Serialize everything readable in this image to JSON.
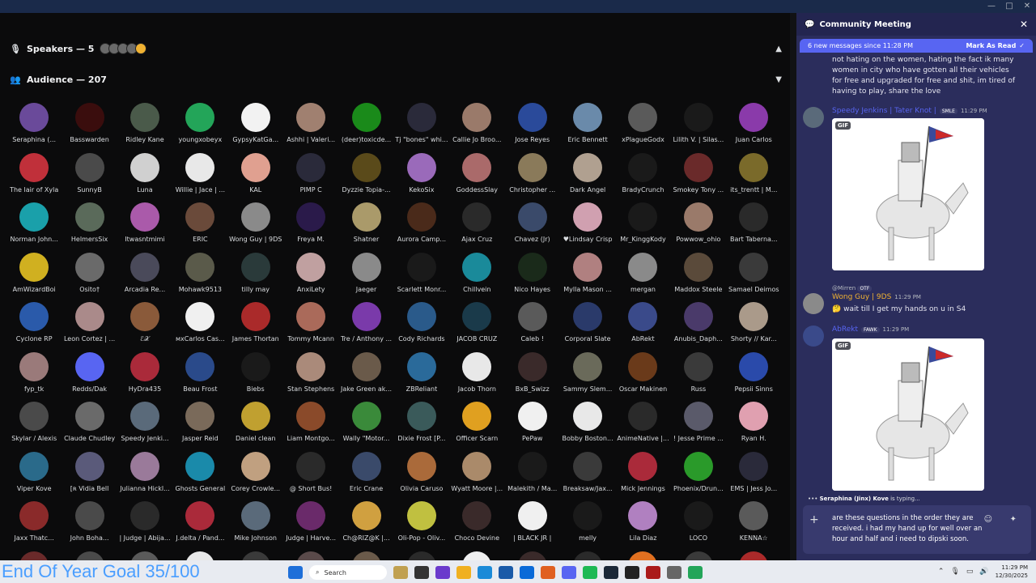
{
  "window": {
    "controls": [
      "—",
      "□",
      "✕"
    ]
  },
  "stage": {
    "speakers": {
      "label": "Speakers — 5"
    },
    "audience": {
      "label": "Audience — 207"
    },
    "members": [
      {
        "name": "Seraphina (...",
        "c": "#6a4a9a"
      },
      {
        "name": "Basswarden",
        "c": "#3a0d0d"
      },
      {
        "name": "Ridley Kane",
        "c": "#4a5a4a"
      },
      {
        "name": "youngxobeyx",
        "c": "#23a559"
      },
      {
        "name": "GypsyKatGa...",
        "c": "#f2f2f2"
      },
      {
        "name": "Ashhi | Valeri...",
        "c": "#a08070"
      },
      {
        "name": "(deer)toxicde...",
        "c": "#1a8a1a"
      },
      {
        "name": "Tj \"bones\" whi...",
        "c": "#2a2a3a"
      },
      {
        "name": "Callie Jo Broo...",
        "c": "#9a7a6a"
      },
      {
        "name": "Jose Reyes",
        "c": "#2a4a9a"
      },
      {
        "name": "Eric Bennett",
        "c": "#6a8aaa"
      },
      {
        "name": "xPlagueGodx",
        "c": "#5a5a5a"
      },
      {
        "name": "Lilith V. | Silas...",
        "c": "#1a1a1a"
      },
      {
        "name": "Juan Carlos",
        "c": "#8a3aaa"
      },
      {
        "name": "The lair of Xyla",
        "c": "#c0303a"
      },
      {
        "name": "SunnyB",
        "c": "#4a4a4a"
      },
      {
        "name": "Luna",
        "c": "#d0d0d0"
      },
      {
        "name": "Willie | Jace | ...",
        "c": "#e8e8e8"
      },
      {
        "name": "KAL",
        "c": "#e0a090"
      },
      {
        "name": "PIMP C",
        "c": "#2a2a3a"
      },
      {
        "name": "Dyzzie Topia-...",
        "c": "#5a4a1a"
      },
      {
        "name": "KekoSix",
        "c": "#9a6aba"
      },
      {
        "name": "GoddessSlay",
        "c": "#aa6a6a"
      },
      {
        "name": "Christopher ...",
        "c": "#8a7a5a"
      },
      {
        "name": "Dark Angel",
        "c": "#b0a090"
      },
      {
        "name": "BradyCrunch",
        "c": "#1a1a1a"
      },
      {
        "name": "Smokey Tony ...",
        "c": "#6a2a2a"
      },
      {
        "name": "its_trentt | M...",
        "c": "#7a6a2a"
      },
      {
        "name": "Norman John...",
        "c": "#1aa0aa"
      },
      {
        "name": "HelmersSix",
        "c": "#5a6a5a"
      },
      {
        "name": "Itwasntmimi",
        "c": "#aa5aaa"
      },
      {
        "name": "ERIC",
        "c": "#6a4a3a"
      },
      {
        "name": "Wong Guy | 9DS",
        "c": "#8a8a8a"
      },
      {
        "name": "Freya M.",
        "c": "#2a1a4a"
      },
      {
        "name": "Shatner",
        "c": "#aa9a6a"
      },
      {
        "name": "Aurora Camp...",
        "c": "#4a2a1a"
      },
      {
        "name": "Ajax Cruz",
        "c": "#2a2a2a"
      },
      {
        "name": "Chavez (Jr)",
        "c": "#3a4a6a"
      },
      {
        "name": "♥Lindsay Crisp",
        "c": "#d0a0b0"
      },
      {
        "name": "Mr_KinggKody",
        "c": "#1a1a1a"
      },
      {
        "name": "Powwow_ohio",
        "c": "#9a7a6a"
      },
      {
        "name": "Bart Taberna...",
        "c": "#2a2a2a"
      },
      {
        "name": "AmWizardBoi",
        "c": "#d0b020"
      },
      {
        "name": "Osito†",
        "c": "#6a6a6a"
      },
      {
        "name": "Arcadia Re...",
        "c": "#4a4a5a"
      },
      {
        "name": "Mohawk9513",
        "c": "#5a5a4a"
      },
      {
        "name": "tilly may",
        "c": "#2a3a3a"
      },
      {
        "name": "AnxiLety",
        "c": "#c0a0a0"
      },
      {
        "name": "Jaeger",
        "c": "#8a8a8a"
      },
      {
        "name": "Scarlett Monr...",
        "c": "#1a1a1a"
      },
      {
        "name": "Chillvein",
        "c": "#1a8a9a"
      },
      {
        "name": "Nico Hayes",
        "c": "#1a2a1a"
      },
      {
        "name": "Mylla Mason ...",
        "c": "#b08080"
      },
      {
        "name": "mergan",
        "c": "#8a8a8a"
      },
      {
        "name": "Maddox Steele",
        "c": "#5a4a3a"
      },
      {
        "name": "Samael Deimos",
        "c": "#3a3a3a"
      },
      {
        "name": "Cyclone RP",
        "c": "#2a5aaa"
      },
      {
        "name": "Leon Cortez | ...",
        "c": "#aa8a8a"
      },
      {
        "name": "ℰ𝒳",
        "c": "#8a5a3a"
      },
      {
        "name": "мxCarlos Cas...",
        "c": "#f0f0f0"
      },
      {
        "name": "James Thortan",
        "c": "#aa2a2a"
      },
      {
        "name": "Tommy Mcann",
        "c": "#aa6a5a"
      },
      {
        "name": "Tre / Anthony ...",
        "c": "#7a3aaa"
      },
      {
        "name": "Cody Richards",
        "c": "#2a5a8a"
      },
      {
        "name": "JACOB CRUZ",
        "c": "#1a3a4a"
      },
      {
        "name": "Caleb !",
        "c": "#5a5a5a"
      },
      {
        "name": "Corporal Slate",
        "c": "#2a3a6a"
      },
      {
        "name": "AbRekt",
        "c": "#3a4a8a"
      },
      {
        "name": "Anubis_Daph...",
        "c": "#4a3a6a"
      },
      {
        "name": "Shorty // Kar...",
        "c": "#aa9a8a"
      },
      {
        "name": "fyp_tk",
        "c": "#9a7a7a"
      },
      {
        "name": "Redds/Dak",
        "c": "#5865f2"
      },
      {
        "name": "HyDra435",
        "c": "#aa2a3a"
      },
      {
        "name": "Beau Frost",
        "c": "#2a4a8a"
      },
      {
        "name": "Biebs",
        "c": "#1a1a1a"
      },
      {
        "name": "Stan Stephens",
        "c": "#aa8a7a"
      },
      {
        "name": "Jake Green ak...",
        "c": "#6a5a4a"
      },
      {
        "name": "ZBReliant",
        "c": "#2a6a9a"
      },
      {
        "name": "Jacob Thorn",
        "c": "#e8e8e8"
      },
      {
        "name": "BxB_Swizz",
        "c": "#3a2a2a"
      },
      {
        "name": "Sammy Slem...",
        "c": "#6a6a5a"
      },
      {
        "name": "Oscar Makinen",
        "c": "#6a3a1a"
      },
      {
        "name": "Russ",
        "c": "#3a3a3a"
      },
      {
        "name": "Pepsii Sinns",
        "c": "#2a4aaa"
      },
      {
        "name": "Skylar / Alexis",
        "c": "#4a4a4a"
      },
      {
        "name": "Claude Chudley",
        "c": "#6a6a6a"
      },
      {
        "name": "Speedy Jenki...",
        "c": "#5a6a7a"
      },
      {
        "name": "Jasper Reid",
        "c": "#7a6a5a"
      },
      {
        "name": "Daniel clean",
        "c": "#c0a030"
      },
      {
        "name": "Liam Montgo...",
        "c": "#8a4a2a"
      },
      {
        "name": "Wally \"Motor...",
        "c": "#3a8a3a"
      },
      {
        "name": "Dixie Frost [P...",
        "c": "#3a5a5a"
      },
      {
        "name": "Officer Scarn",
        "c": "#e0a020"
      },
      {
        "name": "PePaw",
        "c": "#f0f0f0"
      },
      {
        "name": "Bobby Boston...",
        "c": "#e8e8e8"
      },
      {
        "name": "AnimeNative |...",
        "c": "#2a2a2a"
      },
      {
        "name": "! Jesse Prime ...",
        "c": "#5a5a6a"
      },
      {
        "name": "Ryan H.",
        "c": "#e0a0b0"
      },
      {
        "name": "Viper Kove",
        "c": "#2a6a8a"
      },
      {
        "name": "[ʀ Vidia Bell",
        "c": "#5a5a7a"
      },
      {
        "name": "Julianna Hickl...",
        "c": "#9a7a9a"
      },
      {
        "name": "Ghosts General",
        "c": "#1a8aaa"
      },
      {
        "name": "Corey Crowle...",
        "c": "#c0a080"
      },
      {
        "name": "@ Short Bus!",
        "c": "#2a2a2a"
      },
      {
        "name": "Eric Crane",
        "c": "#3a4a6a"
      },
      {
        "name": "Olivia Caruso",
        "c": "#aa6a3a"
      },
      {
        "name": "Wyatt Moore |...",
        "c": "#aa8a6a"
      },
      {
        "name": "Malekith / Ma...",
        "c": "#1a1a1a"
      },
      {
        "name": "Breaksaw/Jax...",
        "c": "#3a3a3a"
      },
      {
        "name": "Mick Jennings",
        "c": "#aa2a3a"
      },
      {
        "name": "Phoenix/Drun...",
        "c": "#2a9a2a"
      },
      {
        "name": "EMS | Jess Jo...",
        "c": "#2a2a3a"
      },
      {
        "name": "Jaxx Thatc...",
        "c": "#8a2a2a"
      },
      {
        "name": "John Boha...",
        "c": "#4a4a4a"
      },
      {
        "name": "| Judge | Abija...",
        "c": "#2a2a2a"
      },
      {
        "name": "J.delta / Pand...",
        "c": "#aa2a3a"
      },
      {
        "name": "Mike Johnson",
        "c": "#5a6a7a"
      },
      {
        "name": "Judge | Harve...",
        "c": "#6a2a6a"
      },
      {
        "name": "Ch@RIZ@K |...",
        "c": "#d0a040"
      },
      {
        "name": "Oli-Pop - Oliv...",
        "c": "#c0c040"
      },
      {
        "name": "Choco Devine",
        "c": "#3a2a2a"
      },
      {
        "name": "| BLACK JR |",
        "c": "#f0f0f0"
      },
      {
        "name": "melly",
        "c": "#1a1a1a"
      },
      {
        "name": "Lila Diaz",
        "c": "#b080c0"
      },
      {
        "name": "LOCO",
        "c": "#1a1a1a"
      },
      {
        "name": "KENNA☆",
        "c": "#5a5a5a"
      },
      {
        "name": "",
        "c": "#6a2a2a"
      },
      {
        "name": "",
        "c": "#4a4a4a"
      },
      {
        "name": "",
        "c": "#5a5a5a"
      },
      {
        "name": "",
        "c": "#e8e8e8"
      },
      {
        "name": "",
        "c": "#3a3a3a"
      },
      {
        "name": "",
        "c": "#5a4a4a"
      },
      {
        "name": "",
        "c": "#6a5a4a"
      },
      {
        "name": "",
        "c": "#2a2a2a"
      },
      {
        "name": "",
        "c": "#f0f0f0"
      },
      {
        "name": "",
        "c": "#3a2a2a"
      },
      {
        "name": "",
        "c": "#2a2a2a"
      },
      {
        "name": "",
        "c": "#e07020"
      },
      {
        "name": "",
        "c": "#3a3a3a"
      },
      {
        "name": "",
        "c": "#aa2a2a"
      }
    ]
  },
  "goal": {
    "text": "End Of Year Goal 35/100"
  },
  "chat": {
    "title": "Community Meeting",
    "new_messages": "6 new messages since 11:28 PM",
    "mark_read": "Mark As Read",
    "top_text": "not hating on the women, hating the fact ik many women in city who have gotten all their vehicles for free and upgraded for free and shit, im tired of having to play, share the love",
    "msg1": {
      "author": "Speedy Jenkins | Tater Knot |",
      "tag": "SMLE",
      "time": "11:29 PM",
      "gif_label": "GIF",
      "color": "#5865f2"
    },
    "reply_to": "@Mirren",
    "reply_tag": "OTF",
    "msg2": {
      "author": "Wong Guy | 9DS",
      "time": "11:29 PM",
      "text": "wait till I get my hands on u in S4",
      "color": "#f0b232"
    },
    "msg3": {
      "author": "AbRekt",
      "tag": "FAWK",
      "time": "11:29 PM",
      "gif_label": "GIF",
      "color": "#5865f2"
    },
    "typing": "Seraphina (Jinx) Kove",
    "typing_suffix": " is typing...",
    "composer_text": "are these questions in the order they are received. i had my hand up for well over an hour and half and i need to dipski soon."
  },
  "taskbar": {
    "search": "Search",
    "time": "11:29 PM",
    "date": "12/30/2025"
  }
}
